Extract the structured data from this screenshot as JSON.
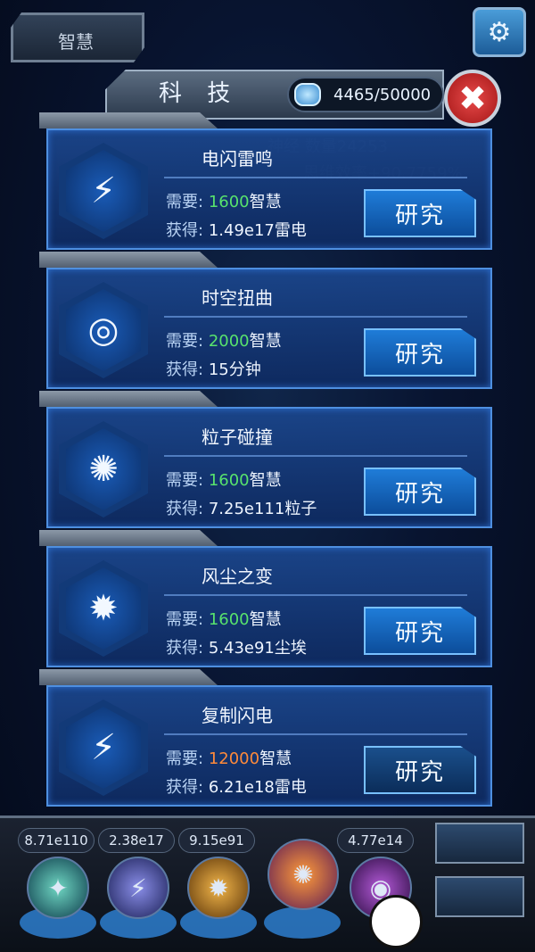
{
  "top": {
    "tab_label": "智慧",
    "settings_icon": "gear-icon"
  },
  "panel": {
    "title": "科 技",
    "wisdom_value": "4465/50000",
    "close_icon": "close-icon"
  },
  "cards": [
    {
      "title": "电闪雷鸣",
      "need_label": "需要:",
      "need_amount": "1600",
      "need_unit": "智慧",
      "amount_color": "green",
      "gain_label": "获得:",
      "gain_value": "1.49e17雷电",
      "button": "研究",
      "icon": "lightning-burst-icon",
      "glyph": "⚡"
    },
    {
      "title": "时空扭曲",
      "need_label": "需要:",
      "need_amount": "2000",
      "need_unit": "智慧",
      "amount_color": "green",
      "gain_label": "获得:",
      "gain_value": "15分钟",
      "button": "研究",
      "icon": "time-warp-icon",
      "glyph": "◎"
    },
    {
      "title": "粒子碰撞",
      "need_label": "需要:",
      "need_amount": "1600",
      "need_unit": "智慧",
      "amount_color": "green",
      "gain_label": "获得:",
      "gain_value": "7.25e111粒子",
      "button": "研究",
      "icon": "particle-collision-icon",
      "glyph": "✺"
    },
    {
      "title": "风尘之变",
      "need_label": "需要:",
      "need_amount": "1600",
      "need_unit": "智慧",
      "amount_color": "green",
      "gain_label": "获得:",
      "gain_value": "5.43e91尘埃",
      "button": "研究",
      "icon": "dust-storm-icon",
      "glyph": "✹"
    },
    {
      "title": "复制闪电",
      "need_label": "需要:",
      "need_amount": "12000",
      "need_unit": "智慧",
      "amount_color": "orange",
      "gain_label": "获得:",
      "gain_value": "6.21e18雷电",
      "button": "研究",
      "icon": "copy-lightning-icon",
      "glyph": "⚡"
    }
  ],
  "bottom": {
    "resources": [
      "8.71e110",
      "2.38e17",
      "9.15e91",
      "4.77e14"
    ]
  },
  "colors": {
    "green": "#58e36d",
    "orange": "#ff8a3a"
  }
}
